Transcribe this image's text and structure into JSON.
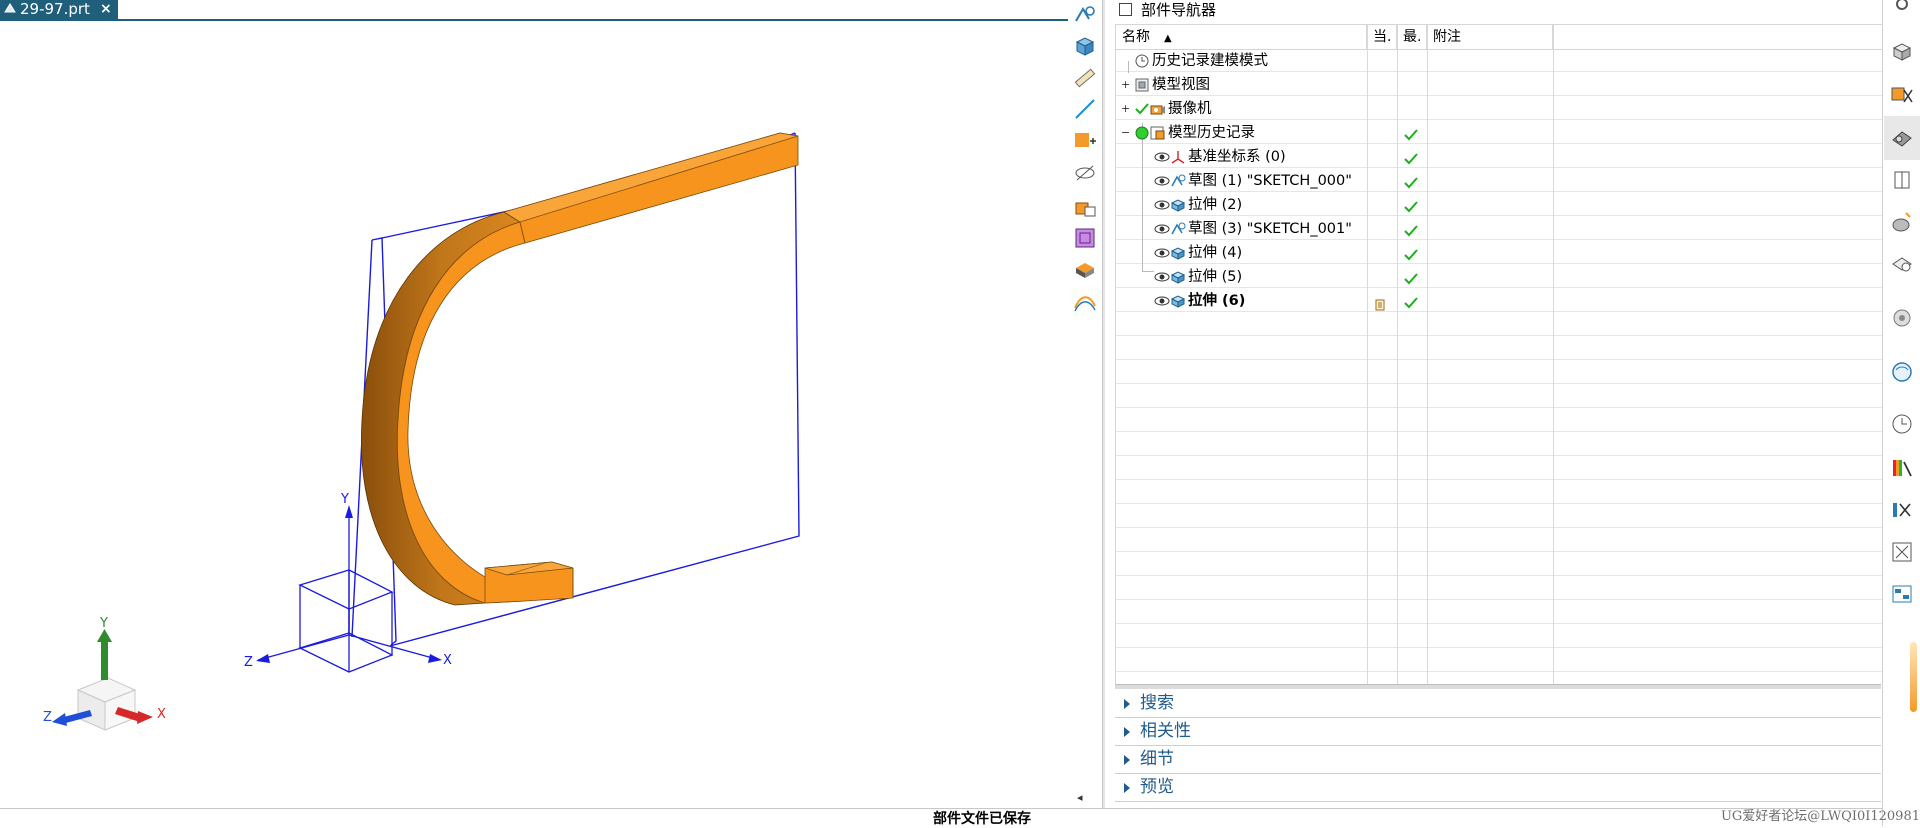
{
  "file_tab": {
    "title": "29-97.prt",
    "close": "×"
  },
  "viewport": {
    "wcs_labels": {
      "x": "X",
      "y": "Y",
      "z": "Z"
    },
    "triad_labels": {
      "x": "X",
      "y": "Y",
      "z": "Z"
    },
    "colors": {
      "solid": "#f7941d",
      "solid_shade": "#b86b12",
      "edge": "#1b1be0",
      "triad_x": "#d62828",
      "triad_y": "#2e8b2e",
      "triad_z": "#1f4fd6"
    }
  },
  "toolbar": {
    "icons": [
      "sketch-tool-icon",
      "solid-view-icon",
      "measure-icon",
      "line-icon",
      "move-object-icon",
      "hide-icon",
      "part-family-icon",
      "box-view-icon",
      "face-shade-icon",
      "curve-surface-icon"
    ],
    "collapse": "◂"
  },
  "navigator": {
    "title": "部件导航器",
    "columns": {
      "name": "名称",
      "current": "当.",
      "updated": "最.",
      "notes": "附注"
    },
    "rows": [
      {
        "label": "历史记录建模模式",
        "icon": "clock-icon",
        "expander": "",
        "checked": false,
        "visible_eye": false
      },
      {
        "label": "模型视图",
        "icon": "model-views-icon",
        "expander": "+",
        "checked": false,
        "visible_eye": false
      },
      {
        "label": "摄像机",
        "icon": "camera-icon",
        "expander": "+",
        "checked": false,
        "visible_eye": false,
        "green_check": true
      },
      {
        "label": "模型历史记录",
        "icon": "history-icon",
        "expander": "−",
        "checked": true,
        "visible_eye": false,
        "status_dot": true
      },
      {
        "label": "基准坐标系 (0)",
        "icon": "datum-csys-icon",
        "expander": "",
        "checked": true,
        "visible_eye": true
      },
      {
        "label": "草图 (1) \"SKETCH_000\"",
        "icon": "sketch-icon",
        "expander": "",
        "checked": true,
        "visible_eye": true
      },
      {
        "label": "拉伸 (2)",
        "icon": "extrude-icon",
        "expander": "",
        "checked": true,
        "visible_eye": true
      },
      {
        "label": "草图 (3) \"SKETCH_001\"",
        "icon": "sketch-icon",
        "expander": "",
        "checked": true,
        "visible_eye": true
      },
      {
        "label": "拉伸 (4)",
        "icon": "extrude-icon",
        "expander": "",
        "checked": true,
        "visible_eye": true
      },
      {
        "label": "拉伸 (5)",
        "icon": "extrude-icon",
        "expander": "",
        "checked": true,
        "visible_eye": true
      },
      {
        "label": "拉伸 (6)",
        "icon": "extrude-icon",
        "expander": "",
        "checked": true,
        "visible_eye": true,
        "current": true,
        "bold": true
      }
    ],
    "sections": [
      "搜索",
      "相关性",
      "细节",
      "预览"
    ]
  },
  "resource_bar": {
    "icons": [
      "settings-icon",
      "part-navigator-icon",
      "assembly-navigator-icon",
      "constraint-navigator-icon",
      "part-view-icon",
      "reuse-library-icon",
      "hd3d-tools-icon",
      "web-browser-icon",
      "history-clock-icon",
      "visualization-icon",
      "role-icon",
      "system-materials-icon",
      "process-studio-icon"
    ]
  },
  "status": {
    "message": "部件文件已保存",
    "watermark": "UG爱好者论坛@LWQI0I120981"
  }
}
